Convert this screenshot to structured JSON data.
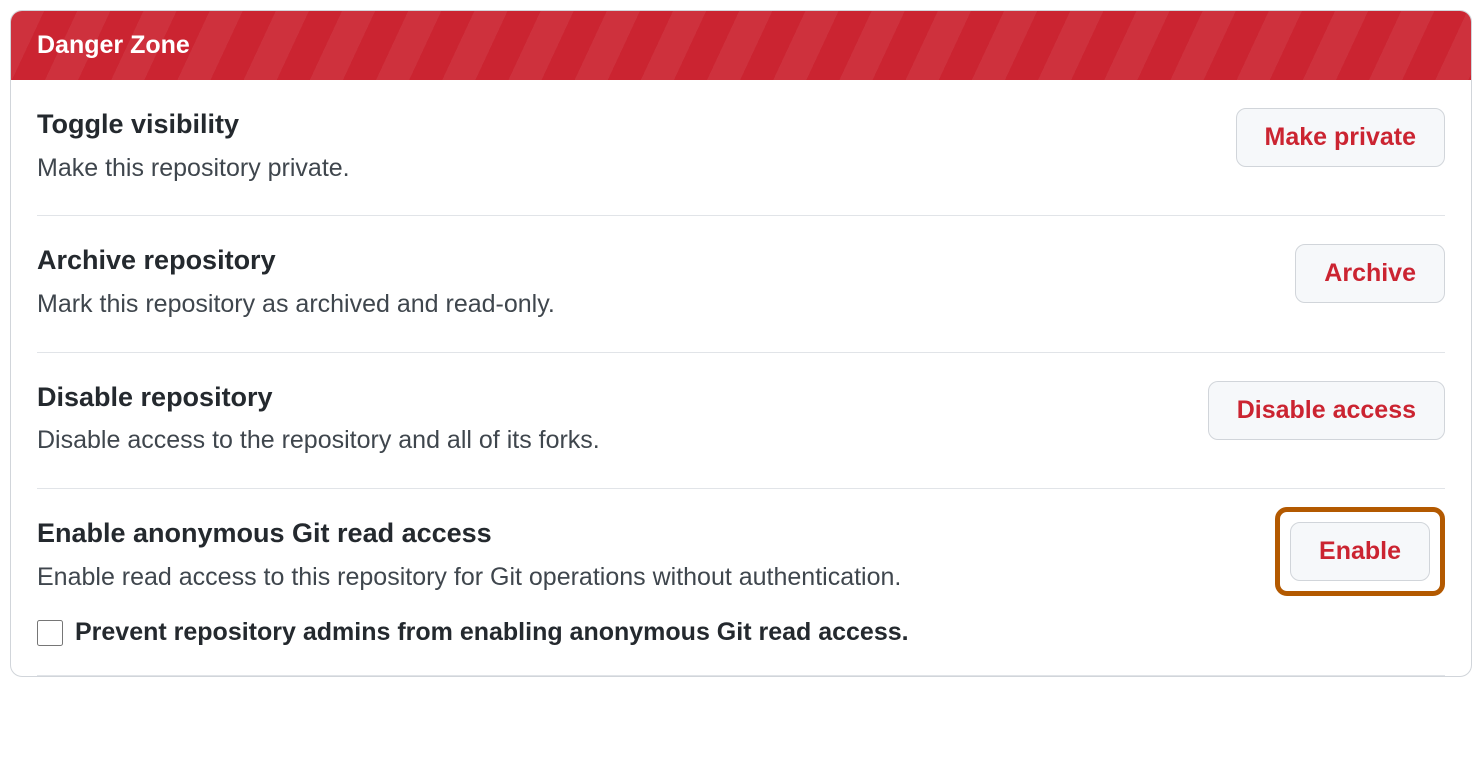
{
  "dangerZone": {
    "header": "Danger Zone",
    "sections": [
      {
        "title": "Toggle visibility",
        "description": "Make this repository private.",
        "buttonLabel": "Make private"
      },
      {
        "title": "Archive repository",
        "description": "Mark this repository as archived and read-only.",
        "buttonLabel": "Archive"
      },
      {
        "title": "Disable repository",
        "description": "Disable access to the repository and all of its forks.",
        "buttonLabel": "Disable access"
      },
      {
        "title": "Enable anonymous Git read access",
        "description": "Enable read access to this repository for Git operations without authentication.",
        "buttonLabel": "Enable",
        "checkboxLabel": "Prevent repository admins from enabling anonymous Git read access."
      }
    ]
  }
}
